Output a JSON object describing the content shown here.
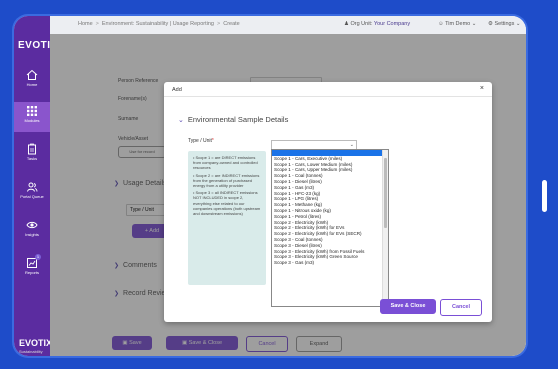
{
  "sidebar": {
    "brand": "EVOTIX",
    "brand_footer": "EVOTIX",
    "brand_footer_sub": "Sustainability",
    "items": [
      {
        "label": "Home",
        "icon": "home-icon"
      },
      {
        "label": "Modules",
        "icon": "grid-icon"
      },
      {
        "label": "Tasks",
        "icon": "clipboard-icon"
      },
      {
        "label": "Portal Queue",
        "icon": "users-icon"
      },
      {
        "label": "Insights",
        "icon": "eye-icon"
      },
      {
        "label": "Reports",
        "icon": "chart-icon",
        "badge": "1"
      }
    ]
  },
  "topbar": {
    "crumbs": [
      "Home",
      "Environment: Sustainability | Usage Reporting",
      "Create"
    ],
    "org_label": "Org Unit:",
    "org_value": "Your Company",
    "user": "Tim Demo",
    "settings": "Settings"
  },
  "page": {
    "person_reference": "Person Reference",
    "forenames": "Forename(s)",
    "surname": "Surname",
    "vehicle": "Vehicle/Asset",
    "vehicle_btn": "Use for record",
    "usage_section": "Usage Details",
    "type_unit_col": "Type / Unit",
    "add_btn": "+ Add",
    "comments_section": "Comments",
    "record_section": "Record Review",
    "footer": {
      "save": "Save",
      "save_close": "Save & Close",
      "cancel": "Cancel",
      "expand": "Expand"
    }
  },
  "modal": {
    "header": "Add",
    "section_title": "Environmental Sample Details",
    "type_label": "Type / Unit",
    "required": "*",
    "info": [
      "• Scope 1 = are DIRECT emissions from company-owned and controlled resources",
      "• Scope 2 = are INDIRECT emissions from the generation of purchased energy from a utility provider",
      "• Scope 3 = all INDIRECT emissions NOT INCLUDED in scope 2, everything else related to our companies operations (both upstream and downstream emissions)"
    ],
    "select_value": "",
    "options": [
      "",
      "Scope 1 - Cars, Executive (miles)",
      "Scope 1 - Cars, Lower Medium (miles)",
      "Scope 1 - Cars, Upper Medium (miles)",
      "Scope 1 - Coal (tonnes)",
      "Scope 1 - Diesel (litres)",
      "Scope 1 - Gas (m3)",
      "Scope 1 - HFC-23 (kg)",
      "Scope 1 - LPG (litres)",
      "Scope 1 - Methane (kg)",
      "Scope 1 - Nitrous oxide (kg)",
      "Scope 1 - Petrol (litres)",
      "Scope 2 - Electricity (kWh)",
      "Scope 2 - Electricity (kWh) for EVs",
      "Scope 2 - Electricity (kWh) for EVs (SECR)",
      "Scope 3 - Coal (tonnes)",
      "Scope 3 - Diesel (litres)",
      "Scope 3 - Electricity (kWh) from Fossil Fuels",
      "Scope 3 - Electricity (kWh) Green Source",
      "Scope 3 - Gas (m3)"
    ],
    "selected_index": 0,
    "save_close": "Save & Close",
    "cancel": "Cancel",
    "close_glyph": "×"
  }
}
